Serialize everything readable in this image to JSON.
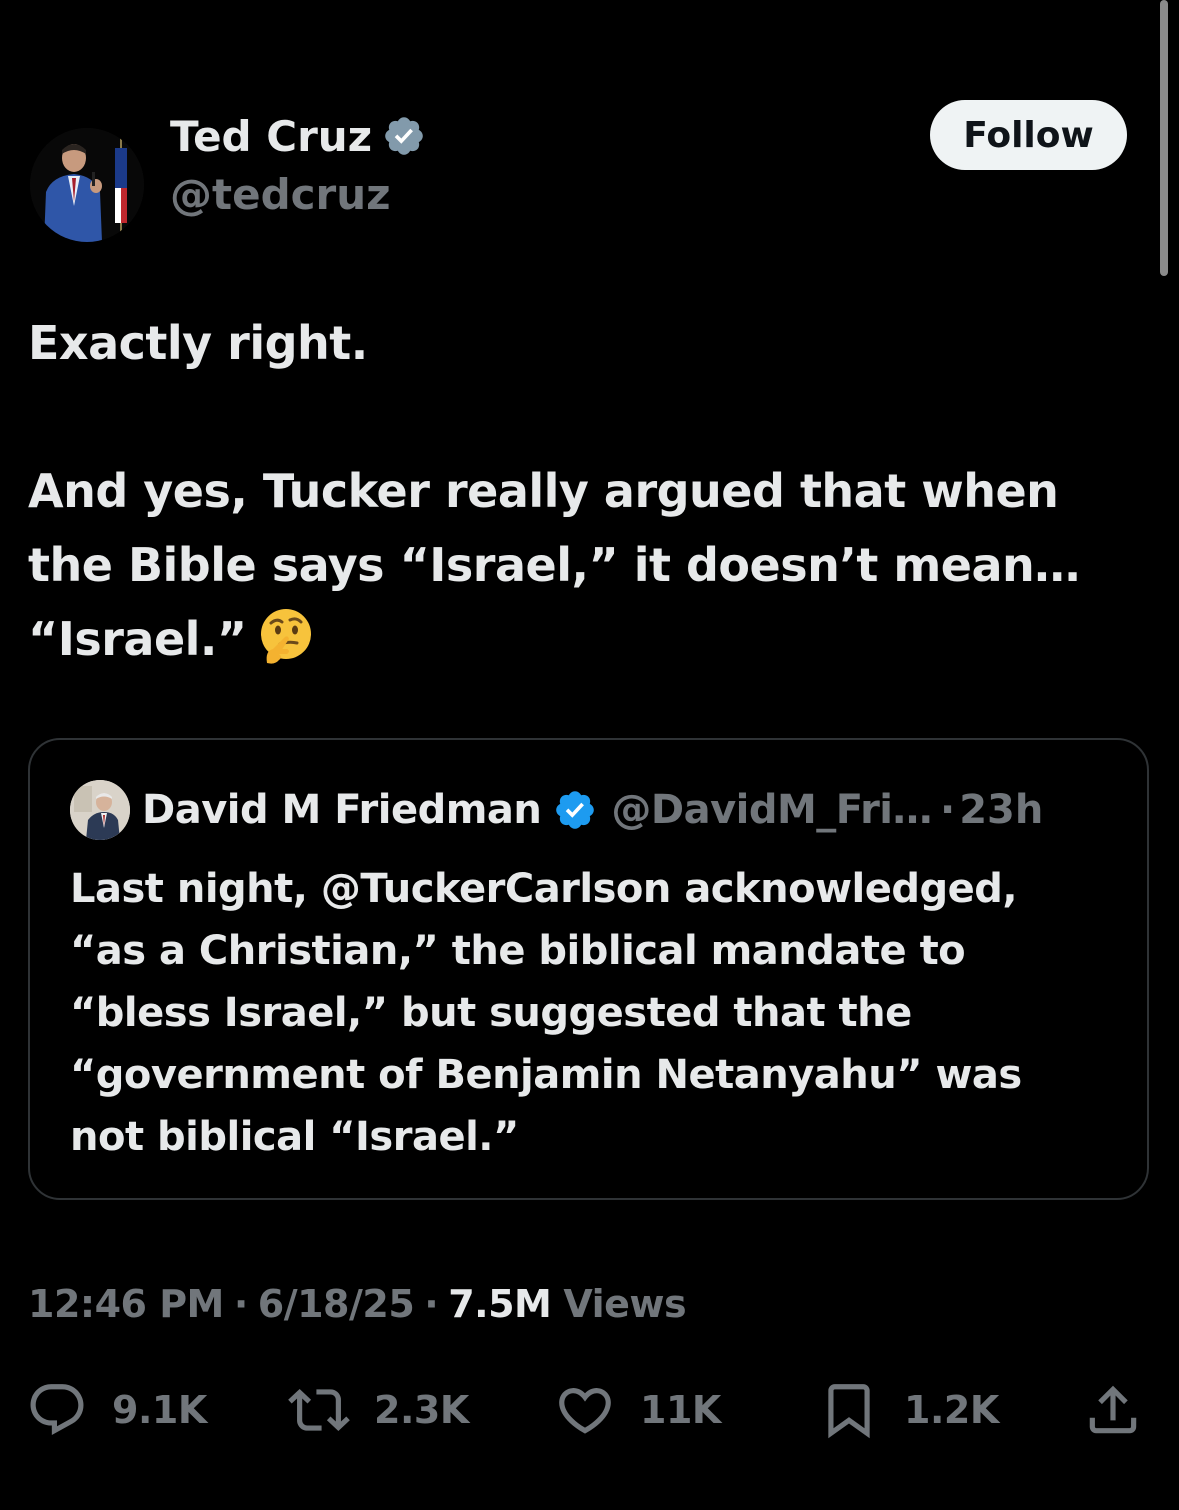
{
  "author": {
    "name": "Ted Cruz",
    "handle": "@tedcruz",
    "follow_label": "Follow"
  },
  "tweet": {
    "lines": [
      "Exactly right.",
      "And yes, Tucker really argued that when",
      "the Bible says “Israel,” it doesn’t mean…",
      "“Israel.”"
    ],
    "emoji": "thinking-face-emoji"
  },
  "quoted": {
    "name": "David M Friedman",
    "handle": "@DavidM_Fri…",
    "separator": "·",
    "time": "23h",
    "lines": [
      "Last night, @TuckerCarlson acknowledged,",
      "“as a Christian,” the biblical mandate to",
      "“bless Israel,” but suggested that the",
      "“government of Benjamin Netanyahu” was",
      "not biblical  “Israel.”"
    ]
  },
  "meta": {
    "time": "12:46 PM",
    "date": "6/18/25",
    "separator": "·",
    "views_count": "7.5M",
    "views_label": "Views"
  },
  "actions": {
    "replies": "9.1K",
    "reposts": "2.3K",
    "likes": "11K",
    "bookmarks": "1.2K"
  },
  "colors": {
    "background": "#000000",
    "text_primary": "#e7e9ea",
    "text_secondary": "#71767b",
    "verified_blue": "#1d9bf0",
    "follow_button_bg": "#eff3f4",
    "border": "#2f3336"
  },
  "icons": [
    "verified-badge-icon",
    "reply-icon",
    "repost-icon",
    "like-icon",
    "bookmark-icon",
    "share-icon"
  ]
}
